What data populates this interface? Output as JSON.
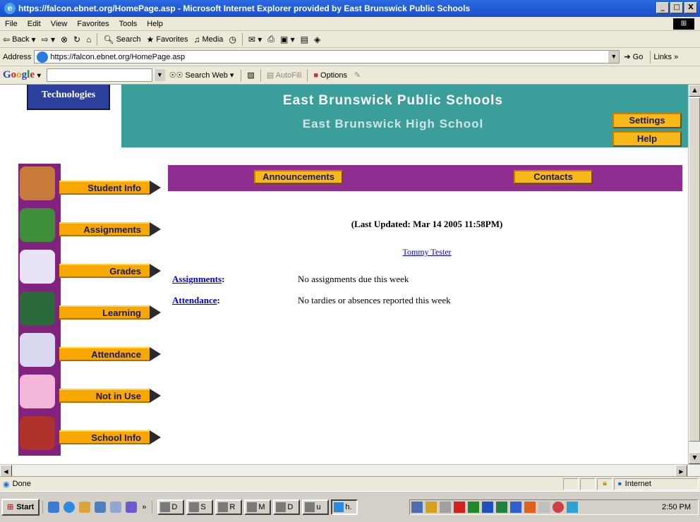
{
  "window": {
    "title": "https://falcon.ebnet.org/HomePage.asp - Microsoft Internet Explorer provided by East Brunswick Public Schools",
    "buttons": [
      "_",
      "□",
      "X"
    ]
  },
  "menu": [
    "File",
    "Edit",
    "View",
    "Favorites",
    "Tools",
    "Help"
  ],
  "toolbar": {
    "back": "Back",
    "search": "Search",
    "favorites": "Favorites",
    "media": "Media"
  },
  "address": {
    "label": "Address",
    "url": "https://falcon.ebnet.org/HomePage.asp",
    "go": "Go",
    "links": "Links"
  },
  "googlebar": {
    "logo": [
      "G",
      "o",
      "o",
      "g",
      "l",
      "e"
    ],
    "search_web": "Search Web",
    "autofill": "AutoFill",
    "options": "Options"
  },
  "page": {
    "logo_text": "Technologies",
    "district": "East Brunswick Public Schools",
    "school": "East Brunswick High School",
    "settings": "Settings",
    "help": "Help",
    "nav": [
      "Student Info",
      "Assignments",
      "Grades",
      "Learning",
      "Attendance",
      "Not in Use",
      "School Info"
    ],
    "nav_icon_colors": [
      "#c87a3a",
      "#3f8f3a",
      "#e9e4f5",
      "#2b6b3b",
      "#d9d9f2",
      "#f2b6d8",
      "#b0302a"
    ],
    "announcements": "Announcements",
    "contacts": "Contacts",
    "last_updated": "(Last Updated: Mar 14 2005 11:58PM)",
    "student": "Tommy Tester",
    "rows": [
      {
        "label": "Assignments",
        "value": "No assignments due this week"
      },
      {
        "label": "Attendance",
        "value": "No tardies or absences reported this week"
      }
    ]
  },
  "status": {
    "text": "Done",
    "zone": "Internet"
  },
  "taskbar": {
    "start": "Start",
    "tasks": [
      "D",
      "S",
      "R",
      "M",
      "D",
      "u",
      "h."
    ],
    "clock": "2:50 PM"
  },
  "colors": {
    "teal": "#3a9e9b",
    "purple": "#8f2d91",
    "nav_purple": "#7f237e",
    "button_yellow": "#f6b81a"
  }
}
